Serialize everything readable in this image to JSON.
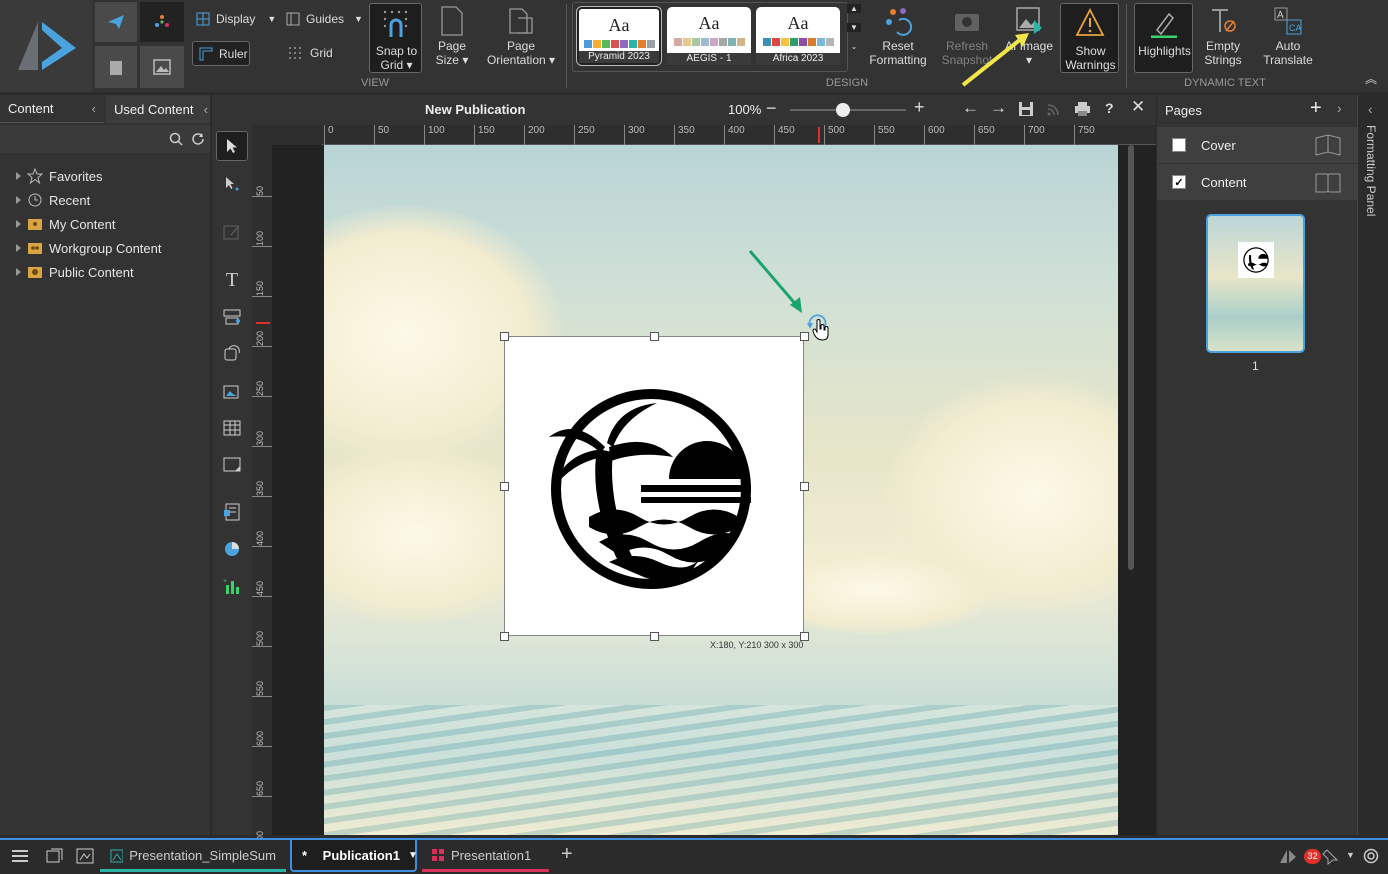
{
  "ribbon": {
    "display_label": "Display",
    "guides_label": "Guides",
    "ruler_label": "Ruler",
    "grid_label": "Grid",
    "snap_label": "Snap to Grid ▾",
    "page_size_label": "Page Size ▾",
    "page_orientation_label": "Page Orientation ▾",
    "view_group": "VIEW",
    "themes": [
      {
        "name": "Pyramid 2023",
        "swatches": [
          "#4e9bd6",
          "#f2b134",
          "#5cb85c",
          "#d9534f",
          "#8e6bbf",
          "#2bb3a6",
          "#e57e31",
          "#9aa0a6"
        ]
      },
      {
        "name": "AEGIS - 1",
        "swatches": [
          "#d9a8a0",
          "#e7c98d",
          "#a9c7a0",
          "#9fbad3",
          "#c9a6c9",
          "#a6a6a6",
          "#7fb3b3",
          "#d0b48a"
        ]
      },
      {
        "name": "Africa 2023",
        "swatches": [
          "#3a8fb7",
          "#e0463e",
          "#f5c242",
          "#2f9e6e",
          "#8d4fa3",
          "#d77a2e",
          "#7ab8d8",
          "#b5b5b5"
        ]
      }
    ],
    "theme_aa": "Aa",
    "reset_formatting_label": "Reset Formatting",
    "refresh_snapshot_label": "Refresh Snapshot",
    "ai_image_label": "AI Image ▾",
    "show_warnings_label": "Show Warnings",
    "design_group": "DESIGN",
    "highlights_label": "Highlights",
    "empty_strings_label": "Empty Strings",
    "auto_translate_label": "Auto Translate",
    "dynamic_text_group": "DYNAMIC TEXT"
  },
  "left_panel": {
    "tab_content": "Content",
    "tab_used_content": "Used Content",
    "tree": [
      "Favorites",
      "Recent",
      "My Content",
      "Workgroup Content",
      "Public Content"
    ]
  },
  "canvas_header": {
    "title": "New Publication",
    "zoom": "100%"
  },
  "ruler": {
    "h_ticks": [
      "0",
      "50",
      "100",
      "150",
      "200",
      "250",
      "300",
      "350",
      "400",
      "450",
      "500",
      "550",
      "600",
      "650",
      "700",
      "750"
    ],
    "v_ticks": [
      "50",
      "100",
      "150",
      "200",
      "250",
      "300",
      "350",
      "400",
      "450",
      "500",
      "550",
      "600",
      "650",
      "700"
    ]
  },
  "selection": {
    "readout": "X:180, Y:210 300 x 300"
  },
  "pages_panel": {
    "title": "Pages",
    "items": [
      {
        "label": "Cover",
        "checked": false
      },
      {
        "label": "Content",
        "checked": true
      }
    ],
    "thumb_number": "1"
  },
  "formatting_panel_label": "Formatting Panel",
  "bottom_tabs": [
    {
      "label": "Presentation_SimpleSum",
      "color": "#2bb3a6"
    },
    {
      "label": "Publication1",
      "prefix": "* ",
      "color": "#3d8fe0"
    },
    {
      "label": "Presentation1",
      "color": "#d9325a"
    }
  ],
  "notification_count": "32"
}
